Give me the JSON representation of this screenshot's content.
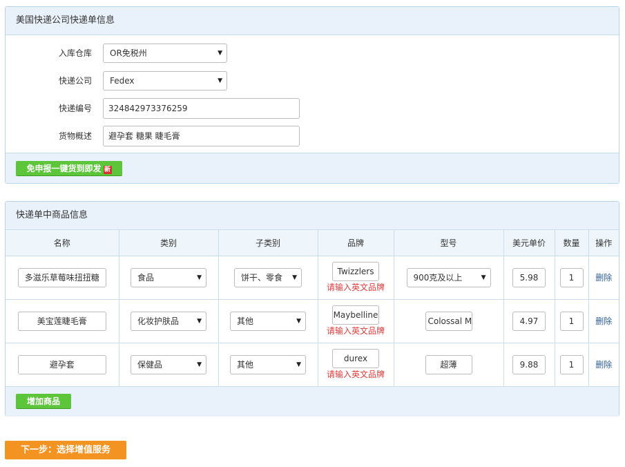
{
  "express_panel": {
    "title": "美国快递公司快递单信息",
    "warehouse_label": "入库仓库",
    "warehouse_value": "OR免税州",
    "carrier_label": "快递公司",
    "carrier_value": "Fedex",
    "tracking_label": "快递编号",
    "tracking_value": "324842973376259",
    "desc_label": "货物概述",
    "desc_value": "避孕套 糖果 睫毛膏",
    "quick_button": "免申报一键货到即发",
    "new_badge": "新"
  },
  "goods_panel": {
    "title": "快递单中商品信息",
    "columns": [
      "名称",
      "类别",
      "子类别",
      "品牌",
      "型号",
      "美元单价",
      "数量",
      "操作"
    ],
    "rows": [
      {
        "name": "多滋乐草莓味扭扭糖",
        "category": "食品",
        "subcategory": "饼干、零食",
        "brand": "Twizzlers",
        "brand_warn": "请输入英文品牌",
        "model": "900克及以上",
        "price": "5.98",
        "qty": "1",
        "action": "删除"
      },
      {
        "name": "美宝莲睫毛膏",
        "category": "化妆护肤品",
        "subcategory": "其他",
        "brand": "Maybelline",
        "brand_warn": "请输入英文品牌",
        "model": "Colossal M",
        "price": "4.97",
        "qty": "1",
        "action": "删除"
      },
      {
        "name": "避孕套",
        "category": "保健品",
        "subcategory": "其他",
        "brand": "durex",
        "brand_warn": "请输入英文品牌",
        "model": "超薄",
        "price": "9.88",
        "qty": "1",
        "action": "删除"
      }
    ],
    "add_button": "增加商品"
  },
  "next_button": "下一步：选择增值服务",
  "colors": {
    "panel_header_bg": "#e9f2fa",
    "panel_border": "#b9d3e9",
    "green_button": "#5cc53a",
    "orange_button": "#f39321",
    "warning_text": "#e03c3c",
    "link": "#2e5f99"
  }
}
